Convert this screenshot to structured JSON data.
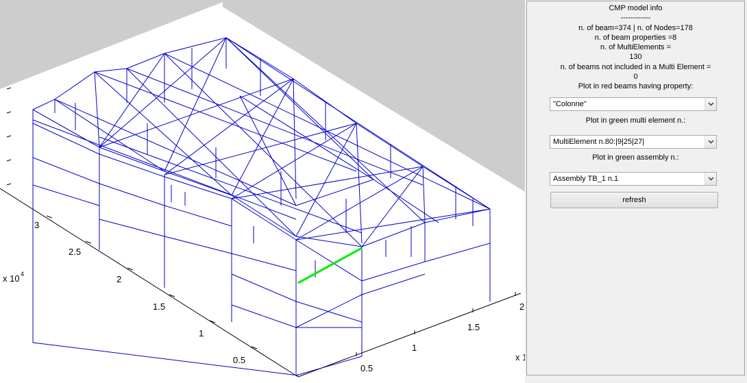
{
  "plot": {
    "left_ticks": [
      "3",
      "2.5",
      "2",
      "1.5",
      "1",
      "0.5"
    ],
    "left_exponent_base": "x 10",
    "left_exponent_power": "4",
    "bottom_ticks": [
      "0.5",
      "1",
      "1.5",
      "2"
    ],
    "bottom_exponent_base": "x 1",
    "colors": {
      "background": "#cdcdcd",
      "wall": "#ffffff",
      "beam": "#0000cc",
      "highlight": "#00ee00"
    }
  },
  "panel": {
    "info_lines": [
      "CMP model info",
      "------------",
      "n. of beam=374 | n. of Nodes=178",
      "n. of beam properties =8",
      "n. of MultiElements =",
      "130",
      "n. of beams not included in a Multi Element =",
      "0",
      "Plot in red beams having property:"
    ],
    "property_select": "\"Colonne\"",
    "multi_label": "Plot in green multi element n.:",
    "multi_select": "MultiElement n.80:|9|25|27|",
    "assembly_label": "Plot in green assembly n.:",
    "assembly_select": "Assembly TB_1 n.1",
    "refresh_label": "refresh"
  }
}
